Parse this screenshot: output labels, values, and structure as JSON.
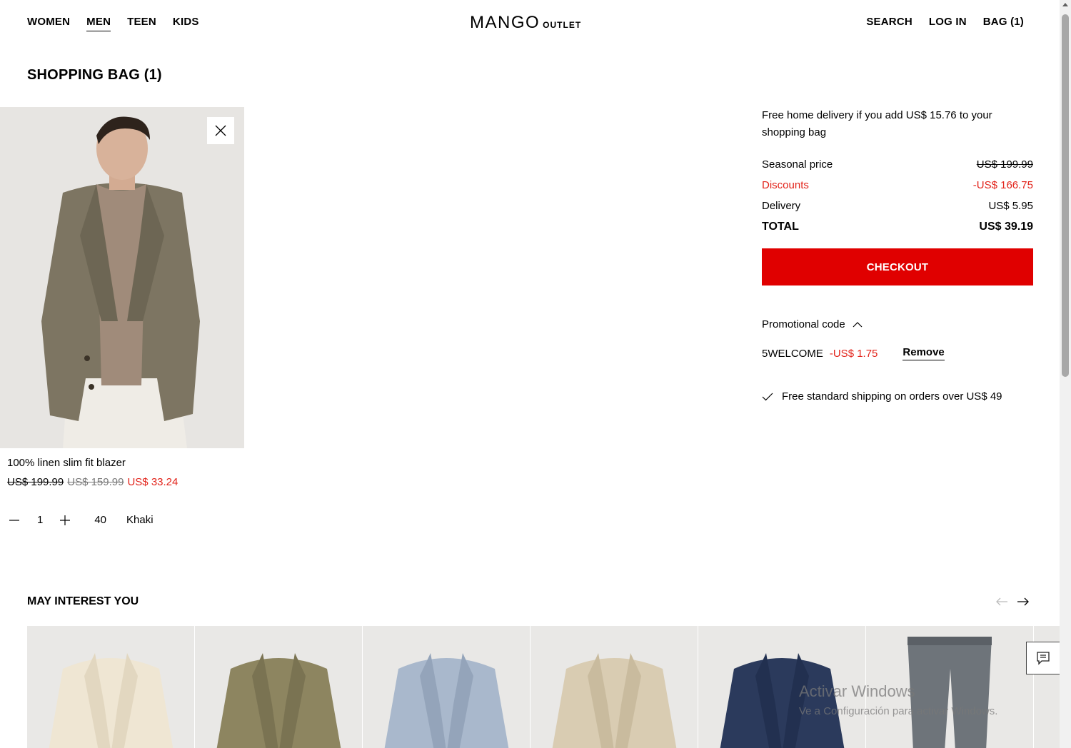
{
  "nav": {
    "left": [
      "WOMEN",
      "MEN",
      "TEEN",
      "KIDS"
    ],
    "active": "MEN",
    "logo_main": "MANGO",
    "logo_sub": "OUTLET",
    "right": {
      "search": "SEARCH",
      "login": "LOG IN",
      "bag": "BAG (1)"
    }
  },
  "page_title": "SHOPPING BAG (1)",
  "item": {
    "name": "100% linen slim fit blazer",
    "price_original": "US$ 199.99",
    "price_previous": "US$ 159.99",
    "price_current": "US$ 33.24",
    "quantity": "1",
    "size": "40",
    "color": "Khaki"
  },
  "summary": {
    "free_delivery_msg": "Free home delivery if you add US$ 15.76 to your shopping bag",
    "seasonal_label": "Seasonal price",
    "seasonal_value": "US$ 199.99",
    "discounts_label": "Discounts",
    "discounts_value": "-US$ 166.75",
    "delivery_label": "Delivery",
    "delivery_value": "US$ 5.95",
    "total_label": "TOTAL",
    "total_value": "US$ 39.19",
    "checkout": "CHECKOUT",
    "promo_label": "Promotional code",
    "promo_code": "5WELCOME",
    "promo_discount": "-US$ 1.75",
    "remove": "Remove",
    "shipping_note": "Free standard shipping on orders over US$ 49"
  },
  "recommendations": {
    "title": "MAY INTEREST YOU",
    "items": [
      {
        "icon": "cream-blazer",
        "color": "#efe6d3"
      },
      {
        "icon": "khaki-blazer",
        "color": "#8d8560"
      },
      {
        "icon": "blue-blazer",
        "color": "#a9b8cc"
      },
      {
        "icon": "beige-blazer",
        "color": "#d9ccb2"
      },
      {
        "icon": "navy-blazer",
        "color": "#2b3a5c"
      },
      {
        "icon": "grey-trousers",
        "color": "#6e747a"
      }
    ]
  },
  "watermark": {
    "title": "Activar Windows",
    "subtitle": "Ve a Configuración para activar Windows."
  },
  "colors": {
    "accent": "#e00000",
    "discount": "#e2231a"
  }
}
